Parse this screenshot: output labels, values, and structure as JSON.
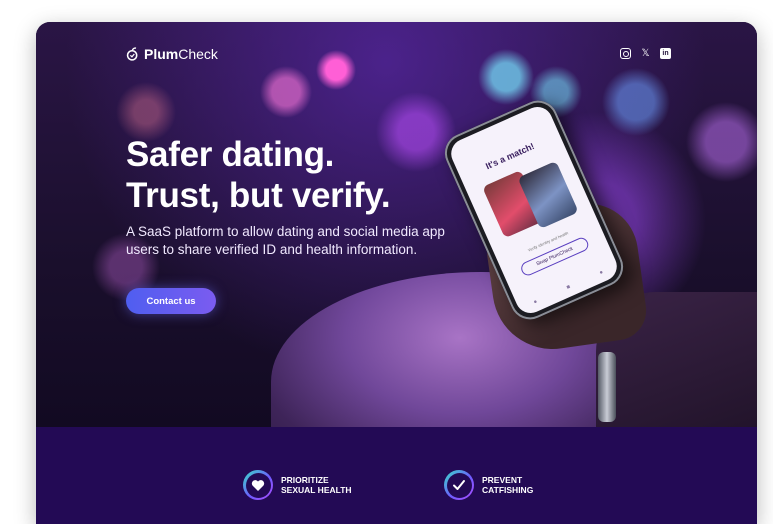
{
  "header": {
    "brand_bold": "Plum",
    "brand_regular": "Check",
    "socials": [
      {
        "icon": "instagram-icon"
      },
      {
        "icon": "x-icon",
        "glyph": "𝕏"
      },
      {
        "icon": "linkedin-icon",
        "glyph": "in"
      }
    ]
  },
  "hero": {
    "title_line1": "Safer dating.",
    "title_line2": "Trust, but verify.",
    "subtitle": "A SaaS platform to allow dating and social media app users to share verified ID and health information.",
    "cta_label": "Contact us"
  },
  "phone": {
    "screen_title": "It's a match!",
    "small_text": "Verify identity and health",
    "pill_label": "Swap PlumCheck"
  },
  "features": [
    {
      "line1": "PRIORITIZE",
      "line2": "SEXUAL HEALTH",
      "icon": "heart-icon"
    },
    {
      "line1": "PREVENT",
      "line2": "CATFISHING",
      "icon": "checkmark-icon"
    }
  ],
  "colors": {
    "band": "#230a55",
    "cta_start": "#4f5ef0",
    "cta_end": "#7b5cf0"
  }
}
